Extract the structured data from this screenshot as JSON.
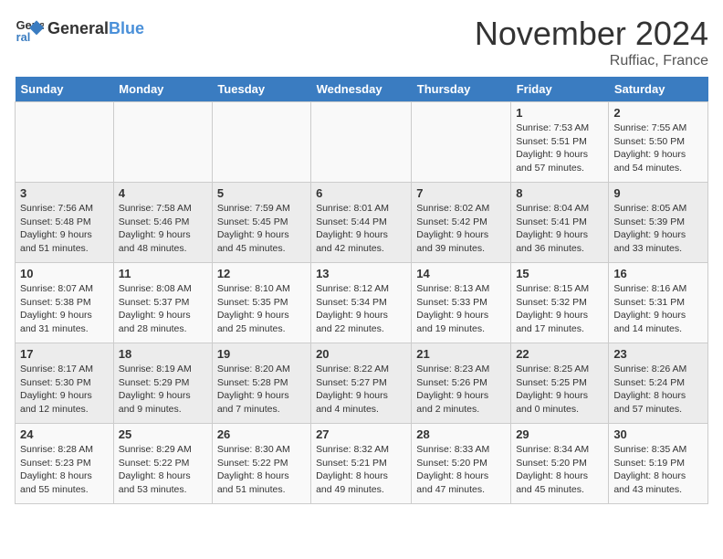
{
  "header": {
    "logo_line1": "General",
    "logo_line2": "Blue",
    "month_title": "November 2024",
    "location": "Ruffiac, France"
  },
  "weekdays": [
    "Sunday",
    "Monday",
    "Tuesday",
    "Wednesday",
    "Thursday",
    "Friday",
    "Saturday"
  ],
  "weeks": [
    [
      {
        "day": "",
        "info": ""
      },
      {
        "day": "",
        "info": ""
      },
      {
        "day": "",
        "info": ""
      },
      {
        "day": "",
        "info": ""
      },
      {
        "day": "",
        "info": ""
      },
      {
        "day": "1",
        "info": "Sunrise: 7:53 AM\nSunset: 5:51 PM\nDaylight: 9 hours and 57 minutes."
      },
      {
        "day": "2",
        "info": "Sunrise: 7:55 AM\nSunset: 5:50 PM\nDaylight: 9 hours and 54 minutes."
      }
    ],
    [
      {
        "day": "3",
        "info": "Sunrise: 7:56 AM\nSunset: 5:48 PM\nDaylight: 9 hours and 51 minutes."
      },
      {
        "day": "4",
        "info": "Sunrise: 7:58 AM\nSunset: 5:46 PM\nDaylight: 9 hours and 48 minutes."
      },
      {
        "day": "5",
        "info": "Sunrise: 7:59 AM\nSunset: 5:45 PM\nDaylight: 9 hours and 45 minutes."
      },
      {
        "day": "6",
        "info": "Sunrise: 8:01 AM\nSunset: 5:44 PM\nDaylight: 9 hours and 42 minutes."
      },
      {
        "day": "7",
        "info": "Sunrise: 8:02 AM\nSunset: 5:42 PM\nDaylight: 9 hours and 39 minutes."
      },
      {
        "day": "8",
        "info": "Sunrise: 8:04 AM\nSunset: 5:41 PM\nDaylight: 9 hours and 36 minutes."
      },
      {
        "day": "9",
        "info": "Sunrise: 8:05 AM\nSunset: 5:39 PM\nDaylight: 9 hours and 33 minutes."
      }
    ],
    [
      {
        "day": "10",
        "info": "Sunrise: 8:07 AM\nSunset: 5:38 PM\nDaylight: 9 hours and 31 minutes."
      },
      {
        "day": "11",
        "info": "Sunrise: 8:08 AM\nSunset: 5:37 PM\nDaylight: 9 hours and 28 minutes."
      },
      {
        "day": "12",
        "info": "Sunrise: 8:10 AM\nSunset: 5:35 PM\nDaylight: 9 hours and 25 minutes."
      },
      {
        "day": "13",
        "info": "Sunrise: 8:12 AM\nSunset: 5:34 PM\nDaylight: 9 hours and 22 minutes."
      },
      {
        "day": "14",
        "info": "Sunrise: 8:13 AM\nSunset: 5:33 PM\nDaylight: 9 hours and 19 minutes."
      },
      {
        "day": "15",
        "info": "Sunrise: 8:15 AM\nSunset: 5:32 PM\nDaylight: 9 hours and 17 minutes."
      },
      {
        "day": "16",
        "info": "Sunrise: 8:16 AM\nSunset: 5:31 PM\nDaylight: 9 hours and 14 minutes."
      }
    ],
    [
      {
        "day": "17",
        "info": "Sunrise: 8:17 AM\nSunset: 5:30 PM\nDaylight: 9 hours and 12 minutes."
      },
      {
        "day": "18",
        "info": "Sunrise: 8:19 AM\nSunset: 5:29 PM\nDaylight: 9 hours and 9 minutes."
      },
      {
        "day": "19",
        "info": "Sunrise: 8:20 AM\nSunset: 5:28 PM\nDaylight: 9 hours and 7 minutes."
      },
      {
        "day": "20",
        "info": "Sunrise: 8:22 AM\nSunset: 5:27 PM\nDaylight: 9 hours and 4 minutes."
      },
      {
        "day": "21",
        "info": "Sunrise: 8:23 AM\nSunset: 5:26 PM\nDaylight: 9 hours and 2 minutes."
      },
      {
        "day": "22",
        "info": "Sunrise: 8:25 AM\nSunset: 5:25 PM\nDaylight: 9 hours and 0 minutes."
      },
      {
        "day": "23",
        "info": "Sunrise: 8:26 AM\nSunset: 5:24 PM\nDaylight: 8 hours and 57 minutes."
      }
    ],
    [
      {
        "day": "24",
        "info": "Sunrise: 8:28 AM\nSunset: 5:23 PM\nDaylight: 8 hours and 55 minutes."
      },
      {
        "day": "25",
        "info": "Sunrise: 8:29 AM\nSunset: 5:22 PM\nDaylight: 8 hours and 53 minutes."
      },
      {
        "day": "26",
        "info": "Sunrise: 8:30 AM\nSunset: 5:22 PM\nDaylight: 8 hours and 51 minutes."
      },
      {
        "day": "27",
        "info": "Sunrise: 8:32 AM\nSunset: 5:21 PM\nDaylight: 8 hours and 49 minutes."
      },
      {
        "day": "28",
        "info": "Sunrise: 8:33 AM\nSunset: 5:20 PM\nDaylight: 8 hours and 47 minutes."
      },
      {
        "day": "29",
        "info": "Sunrise: 8:34 AM\nSunset: 5:20 PM\nDaylight: 8 hours and 45 minutes."
      },
      {
        "day": "30",
        "info": "Sunrise: 8:35 AM\nSunset: 5:19 PM\nDaylight: 8 hours and 43 minutes."
      }
    ]
  ]
}
